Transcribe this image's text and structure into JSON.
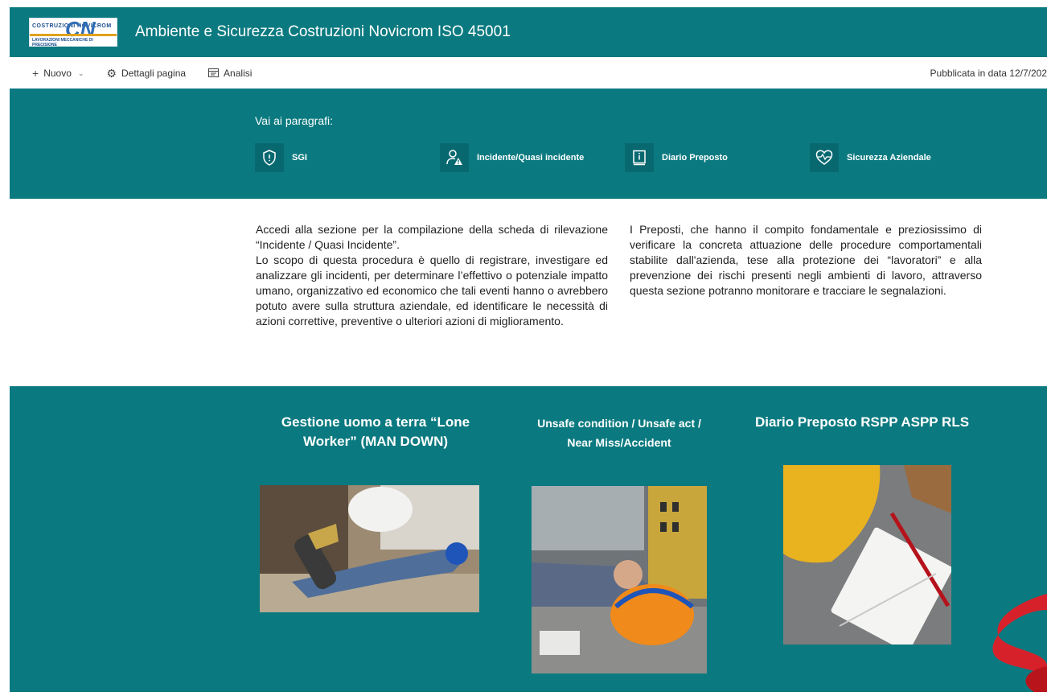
{
  "header": {
    "logo": {
      "top_text": "COSTRUZIONI NOVICROM",
      "mark": "CN",
      "bottom_text": "LAVORAZIONI MECCANICHE DI PRECISIONE"
    },
    "title": "Ambiente e Sicurezza Costruzioni Novicrom ISO 45001"
  },
  "commandbar": {
    "new_label": "Nuovo",
    "details_label": "Dettagli pagina",
    "analytics_label": "Analisi",
    "published": "Pubblicata in data 12/7/202"
  },
  "quicklinks": {
    "title": "Vai ai paragrafi:",
    "items": [
      {
        "label": "SGI",
        "icon": "shield-icon"
      },
      {
        "label": "Incidente/Quasi incidente",
        "icon": "person-warning-icon"
      },
      {
        "label": "Diario Preposto",
        "icon": "book-info-icon"
      },
      {
        "label": "Sicurezza Aziendale",
        "icon": "heart-pulse-icon"
      }
    ]
  },
  "text": {
    "left_p1": "Accedi alla sezione per la compilazione della scheda di rilevazione “Incidente / Quasi Incidente”.",
    "left_p2": "Lo scopo di questa procedura è quello di registrare, investigare ed analizzare gli incidenti, per determinare l’effettivo o potenziale impatto umano, organizzativo ed economico che tali eventi hanno o avrebbero potuto avere sulla struttura aziendale, ed identificare le necessità di azioni correttive, preventive o ulteriori azioni di miglioramento.",
    "right": "I Preposti, che hanno il compito fondamentale e preziosissimo di verificare la concreta attuazione delle procedure comportamentali stabilite dall'azienda, tese alla protezione dei “lavoratori” e alla prevenzione dei rischi presenti negli ambienti di lavoro, attraverso questa sezione potranno monitorare e tracciare le segnalazioni."
  },
  "cards": [
    {
      "title_line1": "Gestione uomo a terra “Lone",
      "title_line2": "Worker” (MAN DOWN)"
    },
    {
      "title_line1": "Unsafe condition / Unsafe act /",
      "title_line2": "Near Miss/Accident"
    },
    {
      "title_line1": "Diario Preposto RSPP ASPP RLS",
      "title_line2": ""
    }
  ],
  "colors": {
    "teal": "#0b7a80",
    "teal_dark": "#086870",
    "white": "#ffffff"
  }
}
